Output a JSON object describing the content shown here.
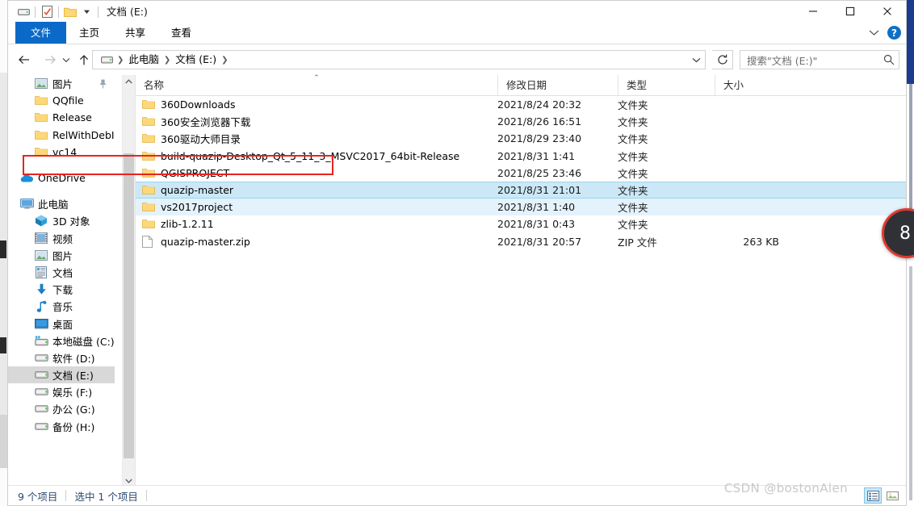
{
  "window": {
    "title": "文档 (E:)",
    "quick_access": [
      "drive-icon",
      "properties-icon",
      "new-folder-icon",
      "customize-dropdown"
    ],
    "controls": {
      "minimize": "—",
      "maximize": "▢",
      "close": "✕"
    }
  },
  "ribbon": {
    "tabs": [
      {
        "label": "文件",
        "active": true
      },
      {
        "label": "主页",
        "active": false
      },
      {
        "label": "共享",
        "active": false
      },
      {
        "label": "查看",
        "active": false
      }
    ],
    "expand_label": "⌄",
    "help_label": "?"
  },
  "navigation": {
    "back": "←",
    "forward": "→",
    "recent": "⌄",
    "up": "↑",
    "breadcrumb": [
      "此电脑",
      "文档 (E:)"
    ],
    "refresh": "↻",
    "dropdown": "⌄"
  },
  "search": {
    "placeholder": "搜索\"文档 (E:)\"",
    "value": ""
  },
  "sidebar": {
    "items": [
      {
        "label": "图片",
        "icon": "picture-icon",
        "indent": 2,
        "pinned": true,
        "selected": false
      },
      {
        "label": "QQfile",
        "icon": "folder-icon",
        "indent": 2,
        "pinned": false,
        "selected": false
      },
      {
        "label": "Release",
        "icon": "folder-icon",
        "indent": 2,
        "pinned": false,
        "selected": false
      },
      {
        "label": "RelWithDebInfo",
        "icon": "folder-icon",
        "indent": 2,
        "pinned": false,
        "selected": false
      },
      {
        "label": "vc14",
        "icon": "folder-icon",
        "indent": 2,
        "pinned": false,
        "selected": false
      },
      {
        "label": "OneDrive",
        "icon": "cloud-icon",
        "indent": 1,
        "pinned": false,
        "selected": false
      },
      {
        "label": "此电脑",
        "icon": "computer-icon",
        "indent": 1,
        "pinned": false,
        "selected": false
      },
      {
        "label": "3D 对象",
        "icon": "3d-object-icon",
        "indent": 2,
        "pinned": false,
        "selected": false
      },
      {
        "label": "视频",
        "icon": "video-icon",
        "indent": 2,
        "pinned": false,
        "selected": false
      },
      {
        "label": "图片",
        "icon": "picture-icon",
        "indent": 2,
        "pinned": false,
        "selected": false
      },
      {
        "label": "文档",
        "icon": "document-icon",
        "indent": 2,
        "pinned": false,
        "selected": false
      },
      {
        "label": "下载",
        "icon": "download-icon",
        "indent": 2,
        "pinned": false,
        "selected": false
      },
      {
        "label": "音乐",
        "icon": "music-icon",
        "indent": 2,
        "pinned": false,
        "selected": false
      },
      {
        "label": "桌面",
        "icon": "desktop-icon",
        "indent": 2,
        "pinned": false,
        "selected": false
      },
      {
        "label": "本地磁盘 (C:)",
        "icon": "system-drive-icon",
        "indent": 2,
        "pinned": false,
        "selected": false
      },
      {
        "label": "软件 (D:)",
        "icon": "drive-icon",
        "indent": 2,
        "pinned": false,
        "selected": false
      },
      {
        "label": "文档 (E:)",
        "icon": "drive-icon",
        "indent": 2,
        "pinned": false,
        "selected": true
      },
      {
        "label": "娱乐 (F:)",
        "icon": "drive-icon",
        "indent": 2,
        "pinned": false,
        "selected": false
      },
      {
        "label": "办公 (G:)",
        "icon": "drive-icon",
        "indent": 2,
        "pinned": false,
        "selected": false
      },
      {
        "label": "备份 (H:)",
        "icon": "drive-icon",
        "indent": 2,
        "pinned": false,
        "selected": false
      }
    ]
  },
  "file_list": {
    "columns": [
      {
        "label": "名称",
        "sorted": true
      },
      {
        "label": "修改日期",
        "sorted": false
      },
      {
        "label": "类型",
        "sorted": false
      },
      {
        "label": "大小",
        "sorted": false
      }
    ],
    "rows": [
      {
        "name": "360Downloads",
        "date": "2021/8/24 20:32",
        "type": "文件夹",
        "size": "",
        "icon": "folder-icon",
        "state": "none"
      },
      {
        "name": "360安全浏览器下载",
        "date": "2021/8/26 16:51",
        "type": "文件夹",
        "size": "",
        "icon": "folder-icon",
        "state": "none"
      },
      {
        "name": "360驱动大师目录",
        "date": "2021/8/29 23:40",
        "type": "文件夹",
        "size": "",
        "icon": "folder-icon",
        "state": "none"
      },
      {
        "name": "build-quazip-Desktop_Qt_5_11_3_MSVC2017_64bit-Release",
        "date": "2021/8/31 1:41",
        "type": "文件夹",
        "size": "",
        "icon": "folder-icon",
        "state": "highlighted"
      },
      {
        "name": "QGISPROJECT",
        "date": "2021/8/25 23:46",
        "type": "文件夹",
        "size": "",
        "icon": "folder-icon",
        "state": "none"
      },
      {
        "name": "quazip-master",
        "date": "2021/8/31 21:01",
        "type": "文件夹",
        "size": "",
        "icon": "folder-icon",
        "state": "selected"
      },
      {
        "name": "vs2017project",
        "date": "2021/8/31 1:40",
        "type": "文件夹",
        "size": "",
        "icon": "folder-icon",
        "state": "selected-soft"
      },
      {
        "name": "zlib-1.2.11",
        "date": "2021/8/31 0:43",
        "type": "文件夹",
        "size": "",
        "icon": "folder-icon",
        "state": "none"
      },
      {
        "name": "quazip-master.zip",
        "date": "2021/8/31 20:57",
        "type": "ZIP 文件",
        "size": "263 KB",
        "icon": "file-icon",
        "state": "none"
      }
    ]
  },
  "status_bar": {
    "item_count": "9 个项目",
    "selection": "选中 1 个项目",
    "views": [
      {
        "name": "details-view",
        "active": true
      },
      {
        "name": "large-icons-view",
        "active": false
      }
    ]
  },
  "watermark": "CSDN @bostonAlen",
  "floating_widget": {
    "value": "8"
  },
  "colors": {
    "accent": "#0b6ac8",
    "highlight_box": "#e8231f",
    "selection": "#cce8f6",
    "folder": "#fcd878"
  }
}
